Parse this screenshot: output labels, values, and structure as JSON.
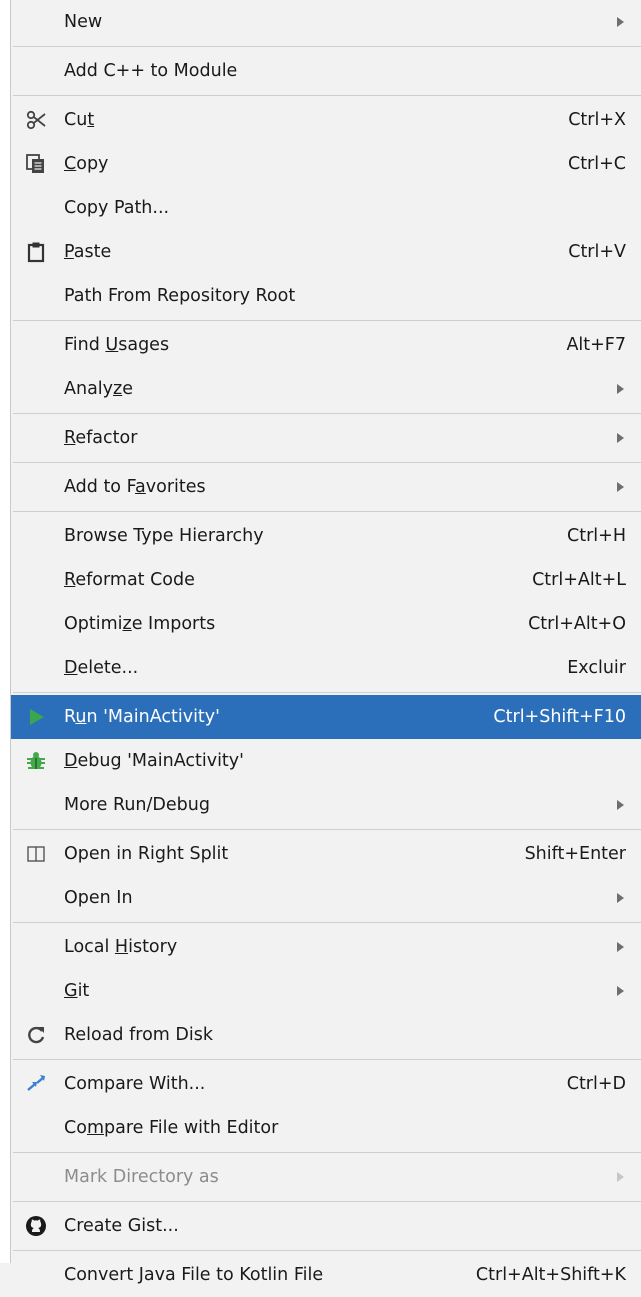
{
  "menu": {
    "new": {
      "label": "New",
      "submenu": true
    },
    "add_cpp": {
      "label": "Add C++ to Module"
    },
    "cut": {
      "pre": "Cu",
      "mn": "t",
      "post": "",
      "shortcut": "Ctrl+X",
      "icon": "cut-icon"
    },
    "copy": {
      "pre": "",
      "mn": "C",
      "post": "opy",
      "shortcut": "Ctrl+C",
      "icon": "copy-icon"
    },
    "copy_path": {
      "label": "Copy Path..."
    },
    "paste": {
      "pre": "",
      "mn": "P",
      "post": "aste",
      "shortcut": "Ctrl+V",
      "icon": "paste-icon"
    },
    "path_from_repo": {
      "label": "Path From Repository Root"
    },
    "find_usages": {
      "pre": "Find ",
      "mn": "U",
      "post": "sages",
      "shortcut": "Alt+F7"
    },
    "analyze": {
      "pre": "Analy",
      "mn": "z",
      "post": "e",
      "submenu": true
    },
    "refactor": {
      "pre": "",
      "mn": "R",
      "post": "efactor",
      "submenu": true
    },
    "add_favorites": {
      "pre": "Add to F",
      "mn": "a",
      "post": "vorites",
      "submenu": true
    },
    "browse_type": {
      "label": "Browse Type Hierarchy",
      "shortcut": "Ctrl+H"
    },
    "reformat": {
      "pre": "",
      "mn": "R",
      "post": "eformat Code",
      "shortcut": "Ctrl+Alt+L"
    },
    "optimize": {
      "pre": "Optimi",
      "mn": "z",
      "post": "e Imports",
      "shortcut": "Ctrl+Alt+O"
    },
    "delete": {
      "pre": "",
      "mn": "D",
      "post": "elete...",
      "shortcut": "Excluir"
    },
    "run": {
      "pre": "R",
      "mn": "u",
      "post": "n 'MainActivity'",
      "shortcut": "Ctrl+Shift+F10",
      "icon": "run-icon",
      "selected": true
    },
    "debug": {
      "pre": "",
      "mn": "D",
      "post": "ebug 'MainActivity'",
      "icon": "debug-icon"
    },
    "more_run": {
      "label": "More Run/Debug",
      "submenu": true
    },
    "open_right_split": {
      "label": "Open in Right Split",
      "shortcut": "Shift+Enter",
      "icon": "split-icon"
    },
    "open_in": {
      "label": "Open In",
      "submenu": true
    },
    "local_history": {
      "pre": "Local ",
      "mn": "H",
      "post": "istory",
      "submenu": true
    },
    "git": {
      "pre": "",
      "mn": "G",
      "post": "it",
      "submenu": true
    },
    "reload": {
      "label": "Reload from Disk",
      "icon": "reload-icon"
    },
    "compare_with": {
      "label": "Compare With...",
      "shortcut": "Ctrl+D",
      "icon": "compare-icon"
    },
    "compare_editor": {
      "pre": "Co",
      "mn": "m",
      "post": "pare File with Editor"
    },
    "mark_dir": {
      "label": "Mark Directory as",
      "submenu": true,
      "disabled": true
    },
    "create_gist": {
      "label": "Create Gist...",
      "icon": "github-icon"
    },
    "convert_kotlin": {
      "label": "Convert Java File to Kotlin File",
      "shortcut": "Ctrl+Alt+Shift+K"
    }
  },
  "colors": {
    "selection": "#2b6fbb",
    "background": "#f2f2f2",
    "run_green": "#3aa64d",
    "debug_green": "#45a84a"
  }
}
